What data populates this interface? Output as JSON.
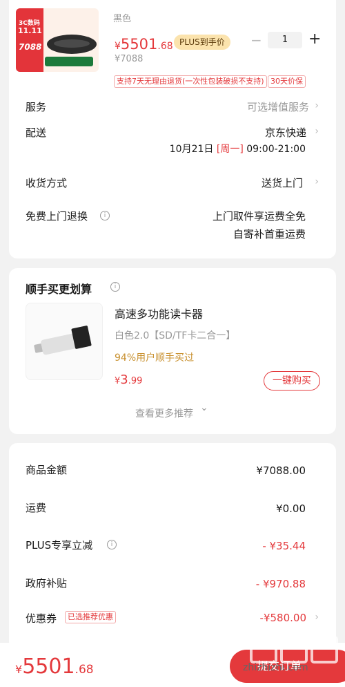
{
  "product": {
    "thumb_badge_top": "3C数码",
    "thumb_badge_date": "11.11",
    "thumb_price": "7088",
    "variant": "黑色",
    "price_symbol": "¥",
    "price_int": "5501",
    "price_dec": ".68",
    "plus_badge": "PLUS到手价",
    "qty_minus": "−",
    "quantity": "1",
    "qty_plus": "+",
    "original_price": "¥7088",
    "tag_return": "支持7天无理由退货(一次性包装破损不支持)",
    "tag_price_protect": "30天价保"
  },
  "rows": {
    "service": {
      "label": "服务",
      "value": "可选增值服务"
    },
    "delivery": {
      "label": "配送",
      "value": "京东快递",
      "time_prefix": "10月21日",
      "time_weekday": "[周一]",
      "time_range": "09:00-21:00"
    },
    "receive": {
      "label": "收货方式",
      "value": "送货上门"
    },
    "free_return": {
      "label": "免费上门退换",
      "value_line1": "上门取件享运费全免",
      "value_line2": "自寄补首重运费"
    }
  },
  "addon": {
    "title": "顺手买更划算",
    "name": "高速多功能读卡器",
    "spec": "白色2.0【SD/TF卡二合一】",
    "stat": "94%用户顺手买过",
    "price_symbol": "¥",
    "price_int": "3",
    "price_dec": ".99",
    "buy_button": "一键购买",
    "more": "查看更多推荐"
  },
  "summary": {
    "goods_label": "商品金额",
    "goods_value": "¥7088.00",
    "freight_label": "运费",
    "freight_value": "¥0.00",
    "plus_label": "PLUS专享立减",
    "plus_value": "- ¥35.44",
    "gov_label": "政府补贴",
    "gov_value": "- ¥970.88",
    "coupon_label": "优惠券",
    "coupon_tag": "已选推荐优惠",
    "coupon_value": "-¥580.00"
  },
  "footer": {
    "total_symbol": "¥",
    "total_int": "5501",
    "total_dec": ".68",
    "submit_button": "提交订单",
    "watermark_text": "zhizhizhi.com"
  },
  "icons": {
    "info": "i",
    "chevron_right": "›",
    "chevron_down": "⌄"
  },
  "colors": {
    "accent": "#e4393c",
    "plus_badge_bg": "#fbe3ad",
    "addon_stat": "#c8902e"
  }
}
